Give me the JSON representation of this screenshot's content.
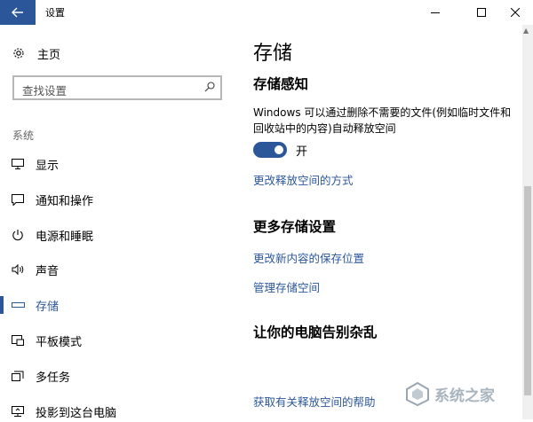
{
  "window": {
    "title": "设置"
  },
  "sidebar": {
    "home_label": "主页",
    "search_placeholder": "查找设置",
    "section_header": "系统",
    "items": [
      {
        "label": "显示",
        "icon": "monitor-icon"
      },
      {
        "label": "通知和操作",
        "icon": "message-icon"
      },
      {
        "label": "电源和睡眠",
        "icon": "power-icon"
      },
      {
        "label": "声音",
        "icon": "speaker-icon"
      },
      {
        "label": "存储",
        "icon": "drive-icon",
        "selected": true
      },
      {
        "label": "平板模式",
        "icon": "tablet-icon"
      },
      {
        "label": "多任务",
        "icon": "multitask-icon"
      },
      {
        "label": "投影到这台电脑",
        "icon": "projector-icon"
      }
    ]
  },
  "main": {
    "page_title": "存储",
    "storage_sense": {
      "heading": "存储感知",
      "description": "Windows 可以通过删除不需要的文件(例如临时文件和回收站中的内容)自动释放空间",
      "toggle_state_label": "开",
      "toggle_on": true,
      "change_link": "更改释放空间的方式"
    },
    "more_settings": {
      "heading": "更多存储设置",
      "link_save_location": "更改新内容的保存位置",
      "link_manage_spaces": "管理存储空间"
    },
    "declutter": {
      "heading": "让你的电脑告别杂乱"
    },
    "help_link": "获取有关释放空间的帮助"
  },
  "watermark": {
    "text": "系统之家"
  },
  "colors": {
    "accent": "#2b579a",
    "text": "#000000",
    "muted": "#666666"
  }
}
